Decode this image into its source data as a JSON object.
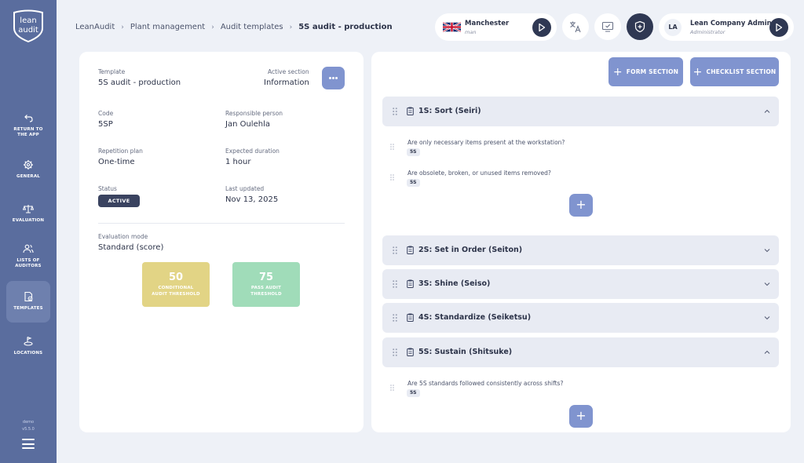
{
  "sidebar": {
    "logo_text": [
      "lean",
      "audit"
    ],
    "items": [
      {
        "label_line1": "RETURN TO",
        "label_line2": "THE APP",
        "icon": "return-icon"
      },
      {
        "label_line1": "GENERAL",
        "label_line2": "",
        "icon": "gear-icon"
      },
      {
        "label_line1": "EVALUATION",
        "label_line2": "",
        "icon": "scales-icon"
      },
      {
        "label_line1": "LISTS OF",
        "label_line2": "AUDITORS",
        "icon": "users-icon"
      },
      {
        "label_line1": "TEMPLATES",
        "label_line2": "",
        "icon": "templates-icon",
        "active": true
      },
      {
        "label_line1": "LOCATIONS",
        "label_line2": "",
        "icon": "location-icon"
      }
    ],
    "env": "demo",
    "version": "v5.5.0"
  },
  "breadcrumb": [
    "LeanAudit",
    "Plant management",
    "Audit templates",
    "5S audit - production"
  ],
  "location": {
    "name": "Manchester",
    "sub": "man"
  },
  "user": {
    "initials": "LA",
    "name": "Lean Company Admin",
    "role": "Administrator"
  },
  "template": {
    "template_label": "Template",
    "template_value": "5S audit - production",
    "active_section_label": "Active section",
    "active_section_value": "Information",
    "code_label": "Code",
    "code_value": "5SP",
    "responsible_label": "Responsible person",
    "responsible_value": "Jan Oulehla",
    "repetition_label": "Repetition plan",
    "repetition_value": "One-time",
    "duration_label": "Expected duration",
    "duration_value": "1 hour",
    "status_label": "Status",
    "status_value": "ACTIVE",
    "updated_label": "Last updated",
    "updated_value": "Nov 13, 2025",
    "eval_mode_label": "Evaluation mode",
    "eval_mode_value": "Standard (score)",
    "conditional": {
      "value": "50",
      "line1": "CONDITIONAL",
      "line2": "AUDIT THRESHOLD"
    },
    "pass": {
      "value": "75",
      "line1": "PASS AUDIT",
      "line2": "THRESHOLD"
    }
  },
  "buttons": {
    "form_section": "FORM SECTION",
    "checklist_section": "CHECKLIST SECTION"
  },
  "sections": [
    {
      "title": "1S: Sort (Seiri)",
      "expanded": true,
      "questions": [
        {
          "text": "Are only necessary items present at the workstation?",
          "tag": "5S"
        },
        {
          "text": "Are obsolete, broken, or unused items removed?",
          "tag": "5S"
        }
      ]
    },
    {
      "title": "2S: Set in Order (Seiton)",
      "expanded": false
    },
    {
      "title": "3S: Shine (Seiso)",
      "expanded": false
    },
    {
      "title": "4S: Standardize (Seiketsu)",
      "expanded": false
    },
    {
      "title": "5S: Sustain (Shitsuke)",
      "expanded": true,
      "questions": [
        {
          "text": "Are 5S standards followed consistently across shifts?",
          "tag": "5S"
        }
      ]
    }
  ],
  "colors": {
    "sidebar": "#5a6d9e",
    "accent": "#8094cf",
    "dark": "#2f3853",
    "conditional": "#e2d485",
    "pass": "#a0dcb9"
  }
}
